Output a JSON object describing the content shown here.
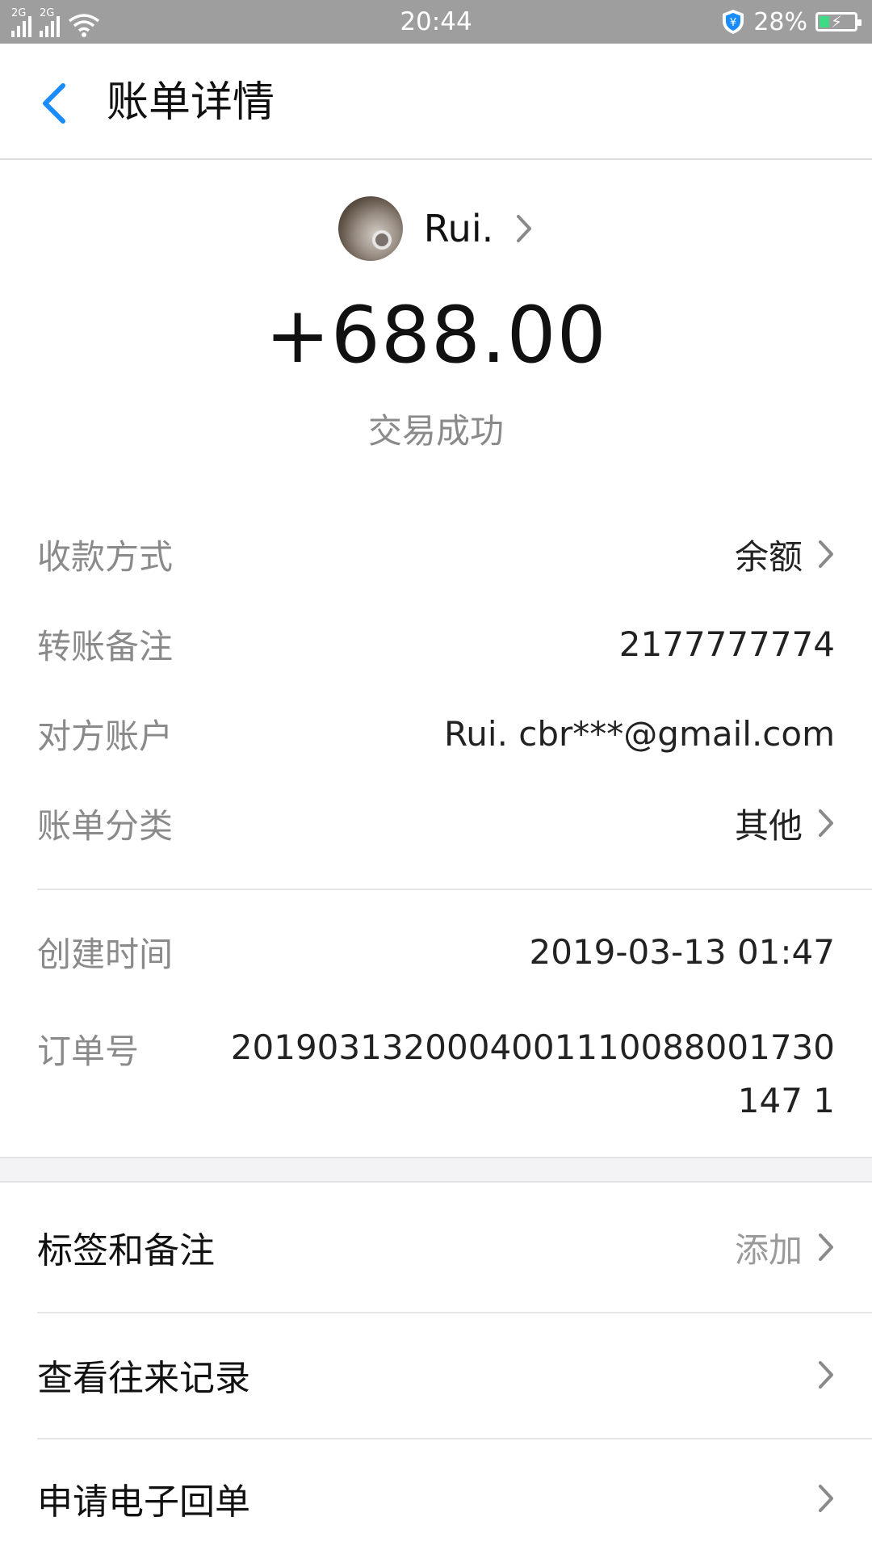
{
  "status_bar": {
    "signal_1_label": "2G",
    "signal_2_label": "2G",
    "time": "20:44",
    "battery_percent": "28%",
    "icons": [
      "signal-icon",
      "wifi-icon",
      "shield-icon",
      "battery-charging-icon"
    ]
  },
  "header": {
    "title": "账单详情"
  },
  "counterparty": {
    "name": "Rui."
  },
  "transaction": {
    "amount": "+688.00",
    "status": "交易成功"
  },
  "details": [
    {
      "label": "收款方式",
      "value": "余额"
    },
    {
      "label": "转账备注",
      "value": "2177777774"
    },
    {
      "label": "对方账户",
      "value": "Rui. cbr***@gmail.com"
    },
    {
      "label": "账单分类",
      "value": "其他"
    }
  ],
  "meta": {
    "created_label": "创建时间",
    "created_value": "2019-03-13 01:47",
    "order_label": "订单号",
    "order_value": "2019031320004001110088001730147 1"
  },
  "actions": {
    "tags_label": "标签和备注",
    "tags_value": "添加",
    "history_label": "查看往来记录",
    "receipt_label": "申请电子回单"
  },
  "colors": {
    "accent": "#1a8cff",
    "status_bar": "#9e9e9e",
    "muted_text": "#8a8a8a"
  }
}
